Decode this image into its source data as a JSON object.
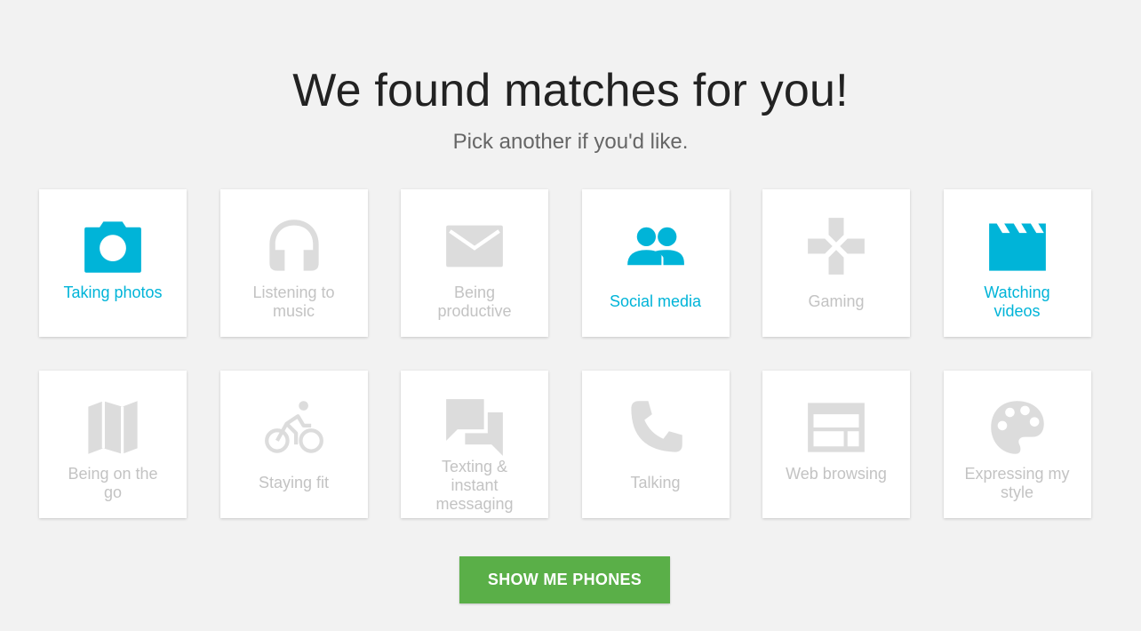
{
  "header": {
    "title": "We found matches for you!",
    "subtitle": "Pick another if you'd like."
  },
  "colors": {
    "selected": "#00b4d8",
    "unselected": "#dcdcdc",
    "button": "#5aaf48"
  },
  "categories": [
    {
      "label": "Taking photos",
      "icon": "camera-icon",
      "selected": true
    },
    {
      "label": "Listening to music",
      "icon": "headphones-icon",
      "selected": false
    },
    {
      "label": "Being productive",
      "icon": "mail-icon",
      "selected": false
    },
    {
      "label": "Social media",
      "icon": "people-icon",
      "selected": true
    },
    {
      "label": "Gaming",
      "icon": "gamepad-icon",
      "selected": false
    },
    {
      "label": "Watching videos",
      "icon": "clapperboard-icon",
      "selected": true
    },
    {
      "label": "Being on the go",
      "icon": "map-icon",
      "selected": false
    },
    {
      "label": "Staying fit",
      "icon": "bicycle-icon",
      "selected": false
    },
    {
      "label": "Texting & instant messaging",
      "icon": "chat-icon",
      "selected": false
    },
    {
      "label": "Talking",
      "icon": "phone-icon",
      "selected": false
    },
    {
      "label": "Web browsing",
      "icon": "browser-icon",
      "selected": false
    },
    {
      "label": "Expressing my style",
      "icon": "palette-icon",
      "selected": false
    }
  ],
  "cta": {
    "label": "SHOW ME PHONES"
  }
}
